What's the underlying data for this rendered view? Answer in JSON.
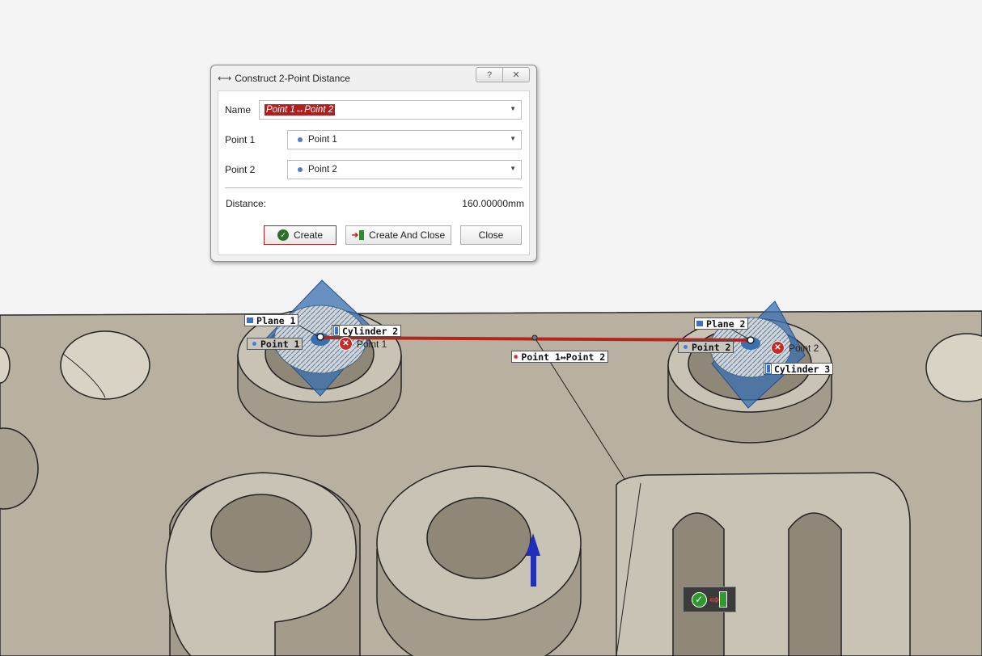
{
  "dialog": {
    "title": "Construct 2-Point Distance",
    "help_label": "?",
    "close_label": "✕",
    "name_label": "Name",
    "name_value": "Point 1↔Point 2",
    "point1_label": "Point 1",
    "point1_value": "Point 1",
    "point2_label": "Point 2",
    "point2_value": "Point 2",
    "distance_label": "Distance:",
    "distance_value": "160.00000mm",
    "create_label": "Create",
    "create_close_label": "Create And Close",
    "close_button_label": "Close"
  },
  "scene": {
    "plane1_label": "Plane 1",
    "cylinder2_label": "Cylinder 2",
    "point1_tag": "Point 1",
    "point1_text": "Point 1",
    "distance_tag": "Point 1↔Point 2",
    "plane2_label": "Plane 2",
    "point2_tag": "Point 2",
    "point2_text": "Point 2",
    "cylinder3_label": "Cylinder 3"
  },
  "colors": {
    "part_face": "#b8b1a2",
    "background": "#f4f4f4",
    "plane_blue": "#3a6fb0",
    "measure_red": "#b3261e",
    "axis_blue": "#1f2fb8"
  }
}
